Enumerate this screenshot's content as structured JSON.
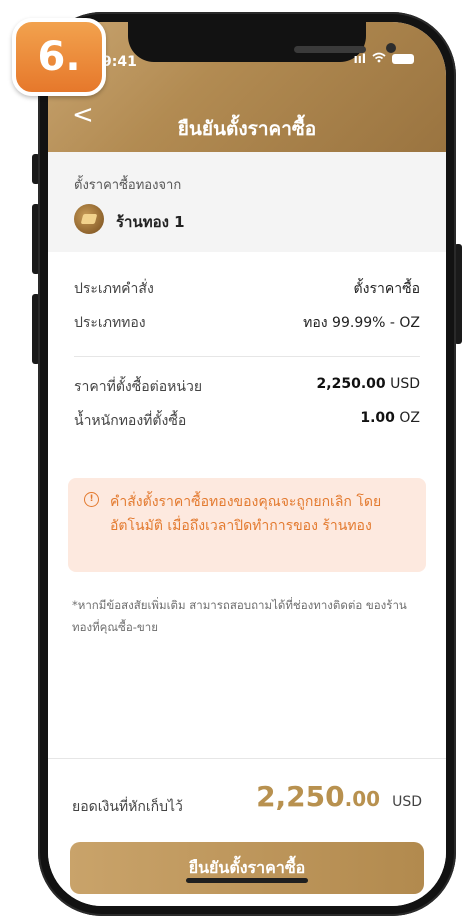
{
  "step_badge": "6.",
  "status_bar": {
    "time": "9:41",
    "signal": "ııl"
  },
  "header": {
    "back": "<",
    "title": "ยืนยันตั้งราคาซื้อ"
  },
  "shop": {
    "from_label": "ตั้งราคาซื้อทองจาก",
    "name": "ร้านทอง 1"
  },
  "order": {
    "type_label": "ประเภทคำสั่ง",
    "type_value": "ตั้งราคาซื้อ",
    "gold_type_label": "ประเภททอง",
    "gold_type_value": "ทอง 99.99% - OZ",
    "price_label": "ราคาที่ตั้งซื้อต่อหน่วย",
    "price_value": "2,250.00",
    "price_unit": "USD",
    "weight_label": "น้ำหนักทองที่ตั้งซื้อ",
    "weight_value": "1.00",
    "weight_unit": "OZ"
  },
  "warning": {
    "icon": "!",
    "text": "คำสั่งตั้งราคาซื้อทองของคุณจะถูกยกเลิก โดยอัตโนมัติ เมื่อถึงเวลาปิดทำการของ ร้านทอง"
  },
  "note": "*หากมีข้อสงสัยเพิ่มเติม สามารถสอบถามได้ที่ช่องทางติดต่อ ของร้านทองที่คุณซื้อ-ขาย",
  "total": {
    "label": "ยอดเงินที่หักเก็บไว้",
    "integer": "2,250",
    "decimal": ".00",
    "unit": "USD"
  },
  "confirm_button": "ยืนยันตั้งราคาซื้อ",
  "colors": {
    "gold": "#b8914f",
    "warning_bg": "#fde9df",
    "warning_text": "#e37a2f",
    "badge": "#ee8a36"
  }
}
